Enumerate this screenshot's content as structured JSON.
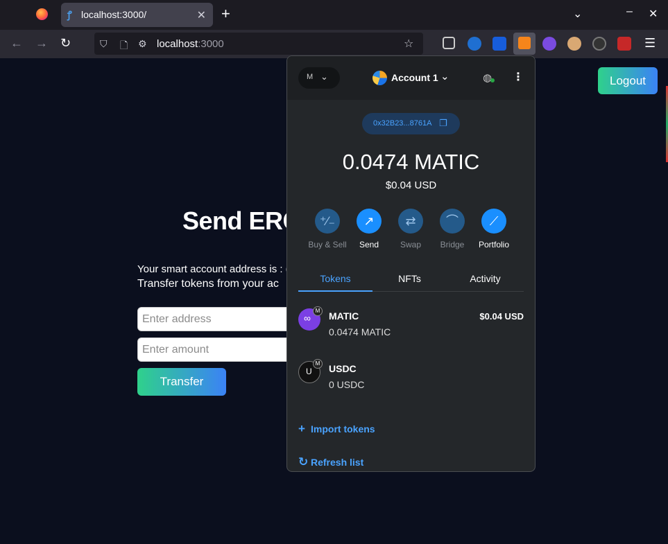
{
  "browser": {
    "tab_title": "localhost:3000/",
    "url_host": "localhost",
    "url_port": ":3000"
  },
  "page": {
    "logout_label": "Logout",
    "heading": "Send ERC",
    "smart_account_text": "Your smart account address is : (",
    "transfer_text": "Transfer tokens from your ac",
    "address_placeholder": "Enter address",
    "amount_placeholder": "Enter amount",
    "transfer_label": "Transfer"
  },
  "wallet": {
    "network_letter": "M",
    "account_name": "Account 1",
    "address_short": "0x32B23...8761A",
    "balance": "0.0474 MATIC",
    "balance_usd": "$0.04 USD",
    "actions": [
      {
        "label": "Buy & Sell",
        "icon": "plus-minus-icon",
        "enabled": false
      },
      {
        "label": "Send",
        "icon": "arrow-up-right-icon",
        "enabled": true
      },
      {
        "label": "Swap",
        "icon": "swap-arrows-icon",
        "enabled": false
      },
      {
        "label": "Bridge",
        "icon": "bridge-icon",
        "enabled": false
      },
      {
        "label": "Portfolio",
        "icon": "chart-line-icon",
        "enabled": true
      }
    ],
    "tabs": [
      "Tokens",
      "NFTs",
      "Activity"
    ],
    "active_tab": "Tokens",
    "tokens": [
      {
        "symbol": "MATIC",
        "balance": "0.0474 MATIC",
        "usd": "$0.04 USD",
        "badge": "M"
      },
      {
        "symbol": "USDC",
        "balance": "0 USDC",
        "usd": "",
        "badge": "M",
        "icon_letter": "U"
      }
    ],
    "import_tokens": "Import tokens",
    "refresh_list": "Refresh list"
  },
  "colors": {
    "accent": "#1a8fff",
    "link": "#4aa3ff",
    "page_bg": "#0b0f1e",
    "gradient_start": "#2fd18b",
    "gradient_end": "#3b82f6"
  }
}
